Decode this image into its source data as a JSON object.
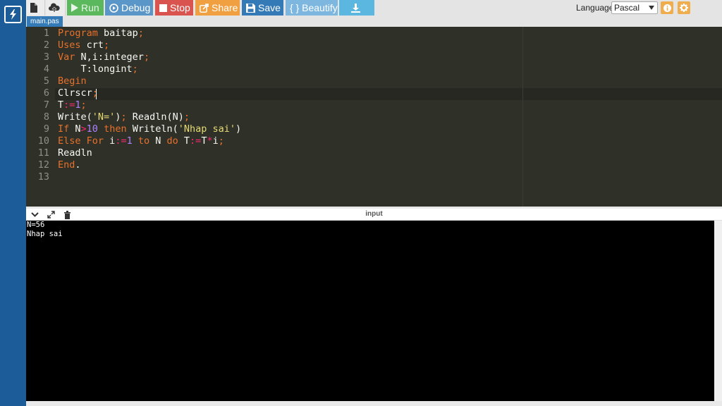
{
  "toolbar": {
    "run_label": "Run",
    "debug_label": "Debug",
    "stop_label": "Stop",
    "share_label": "Share",
    "save_label": "Save",
    "beautify_label": "{ } Beautify",
    "language_label": "Language",
    "language_value": "Pascal"
  },
  "tab": {
    "filename": "main.pas"
  },
  "editor": {
    "lines": [
      [
        [
          "kw",
          "Program"
        ],
        [
          "t",
          " baitap"
        ],
        [
          "kw",
          ";"
        ]
      ],
      [
        [
          "kw",
          "Uses"
        ],
        [
          "t",
          " crt"
        ],
        [
          "kw",
          ";"
        ]
      ],
      [
        [
          "kw",
          "Var"
        ],
        [
          "t",
          " N,i:integer"
        ],
        [
          "kw",
          ";"
        ]
      ],
      [
        [
          "t",
          "    T:longint"
        ],
        [
          "kw",
          ";"
        ]
      ],
      [
        [
          "kw",
          "Begin"
        ]
      ],
      [
        [
          "t",
          "Clrscr"
        ],
        [
          "kw",
          ";"
        ]
      ],
      [
        [
          "t",
          "T"
        ],
        [
          "op",
          ":="
        ],
        [
          "num",
          "1"
        ],
        [
          "kw",
          ";"
        ]
      ],
      [
        [
          "t",
          "Write("
        ],
        [
          "str",
          "'N='"
        ],
        [
          "t",
          ")"
        ],
        [
          "kw",
          ";"
        ],
        [
          "t",
          " Readln(N)"
        ],
        [
          "kw",
          ";"
        ]
      ],
      [
        [
          "kw",
          "If"
        ],
        [
          "t",
          " N"
        ],
        [
          "op",
          ">"
        ],
        [
          "num",
          "10"
        ],
        [
          "t",
          " "
        ],
        [
          "kw",
          "then"
        ],
        [
          "t",
          " Writeln("
        ],
        [
          "str",
          "'Nhap sai'"
        ],
        [
          "t",
          ")"
        ]
      ],
      [
        [
          "kw",
          "Else"
        ],
        [
          "t",
          " "
        ],
        [
          "kw",
          "For"
        ],
        [
          "t",
          " i"
        ],
        [
          "op",
          ":="
        ],
        [
          "num",
          "1"
        ],
        [
          "t",
          " "
        ],
        [
          "kw",
          "to"
        ],
        [
          "t",
          " N "
        ],
        [
          "kw",
          "do"
        ],
        [
          "t",
          " T"
        ],
        [
          "op",
          ":="
        ],
        [
          "t",
          "T"
        ],
        [
          "op",
          "*"
        ],
        [
          "t",
          "i"
        ],
        [
          "kw",
          ";"
        ]
      ],
      [
        [
          "t",
          "Readln"
        ]
      ],
      [
        [
          "kw",
          "End"
        ],
        [
          "t",
          "."
        ]
      ],
      []
    ],
    "line_numbers": [
      "1",
      "2",
      "3",
      "4",
      "5",
      "6",
      "7",
      "8",
      "9",
      "10",
      "11",
      "12",
      "13"
    ]
  },
  "output_panel": {
    "title": "input",
    "console_lines": [
      "N=56",
      "Nhap sai"
    ]
  },
  "colors": {
    "keyword": "#e8702a",
    "number": "#ae81ff",
    "string": "#e6db74",
    "operator": "#f92672",
    "run": "#5cb85c",
    "stop": "#d9534f",
    "save": "#337ab7"
  }
}
